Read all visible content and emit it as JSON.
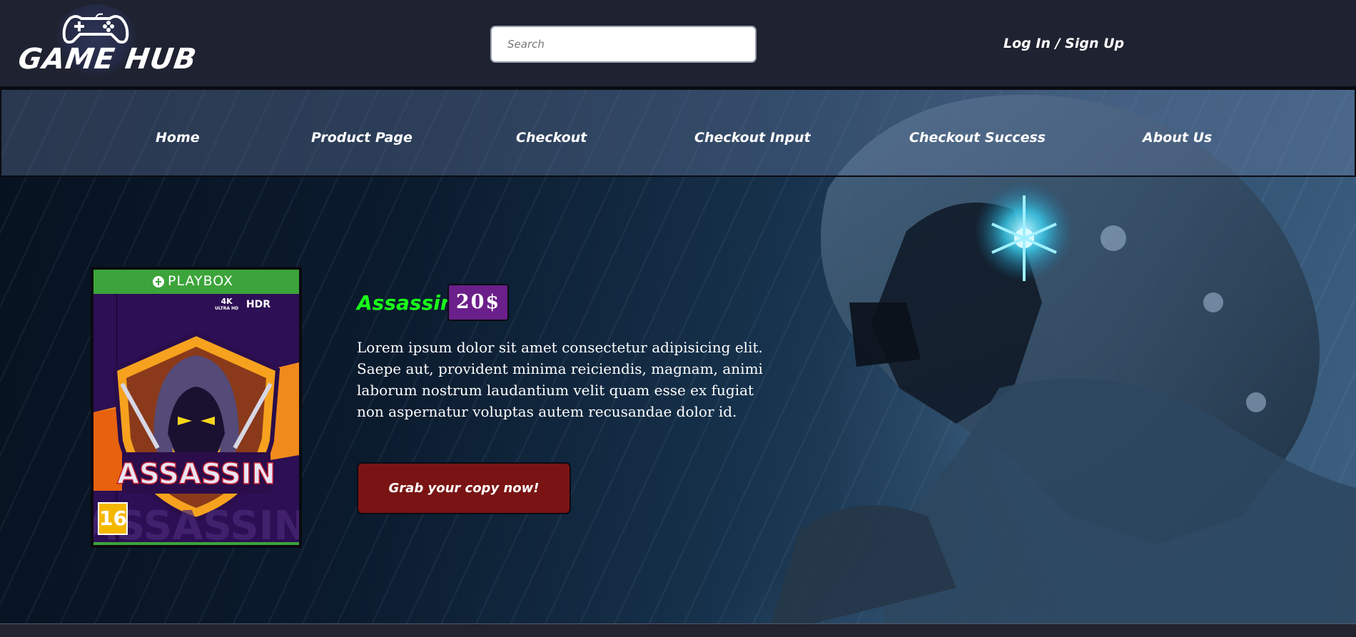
{
  "header": {
    "logo_text": "GAME HUB",
    "search": {
      "placeholder": "Search",
      "value": ""
    },
    "login_label": "Log In / Sign Up"
  },
  "nav": {
    "items": [
      {
        "label": "Home"
      },
      {
        "label": "Product Page"
      },
      {
        "label": "Checkout"
      },
      {
        "label": "Checkout Input"
      },
      {
        "label": "Checkout Success"
      },
      {
        "label": "About Us"
      }
    ]
  },
  "product": {
    "title": "Assassin",
    "price": "20$",
    "description": "Lorem ipsum dolor sit amet consectetur adipisicing elit. Saepe aut, provident minima reiciendis, magnam, animi laborum nostrum laudantium velit quam esse ex fugiat non aspernatur voluptas autem recusandae dolor id.",
    "cta_label": "Grab your copy now!",
    "cover": {
      "platform": "PLAYBOX",
      "badge_4k": "4K",
      "badge_4k_sub": "ULTRA HD",
      "badge_hdr": "HDR",
      "art_title": "ASSASSIN",
      "age_rating": "16"
    }
  },
  "colors": {
    "header_bg": "#1f2230",
    "title_green": "#19ff19",
    "price_purple": "#6b1f8a",
    "cta_red": "#7a1414",
    "cover_green": "#3ca43a"
  },
  "icons": {
    "logo": "gamepad-icon",
    "cover_brand": "playbox-logo-icon"
  }
}
